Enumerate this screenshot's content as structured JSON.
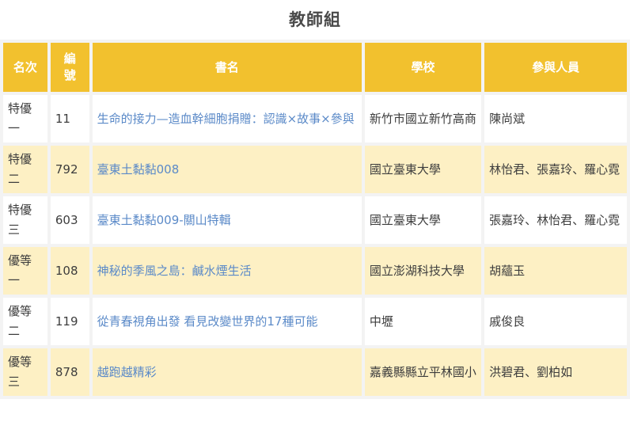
{
  "page": {
    "title": "教師組"
  },
  "table": {
    "headers": {
      "rank": "名次",
      "number": "編號",
      "title": "書名",
      "school": "學校",
      "members": "參與人員"
    },
    "rows": [
      {
        "rank": "特優一",
        "number": "11",
        "title": "生命的接力—造血幹細胞捐贈：認識×故事×參與",
        "school": "新竹市國立新竹高商",
        "members": "陳尚斌"
      },
      {
        "rank": "特優二",
        "number": "792",
        "title": "臺東土黏黏008",
        "school": "國立臺東大學",
        "members": "林怡君、張嘉玲、羅心霓"
      },
      {
        "rank": "特優三",
        "number": "603",
        "title": "臺東土黏黏009-關山特輯",
        "school": "國立臺東大學",
        "members": "張嘉玲、林怡君、羅心霓"
      },
      {
        "rank": "優等一",
        "number": "108",
        "title": "神秘的季風之島：鹹水煙生活",
        "school": "國立澎湖科技大學",
        "members": "胡蘊玉"
      },
      {
        "rank": "優等二",
        "number": "119",
        "title": "從青春視角出發 看見改變世界的17種可能",
        "school": "中壢",
        "members": "戚俊良"
      },
      {
        "rank": "優等三",
        "number": "878",
        "title": "越跑越精彩",
        "school": "嘉義縣縣立平林國小",
        "members": "洪碧君、劉柏如"
      }
    ]
  }
}
